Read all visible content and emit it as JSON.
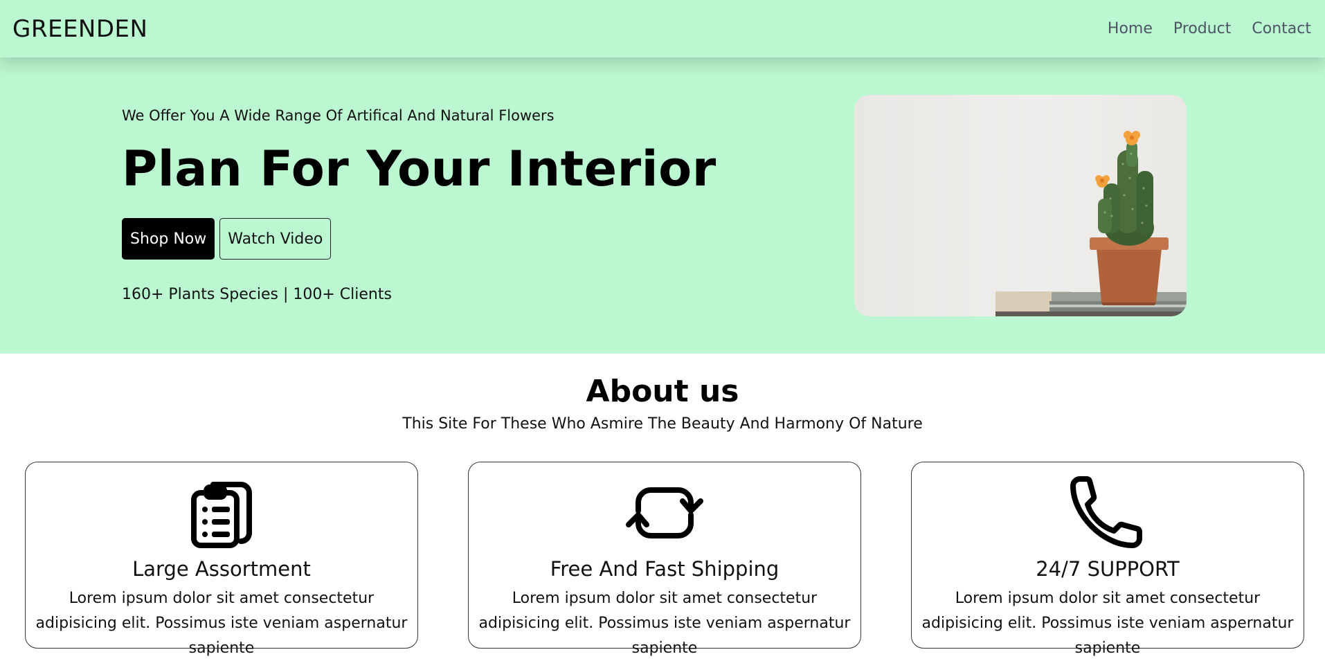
{
  "navbar": {
    "brand": "GREENDEN",
    "links": [
      "Home",
      "Product",
      "Contact"
    ]
  },
  "hero": {
    "tagline": "We Offer You A Wide Range Of Artifical And Natural Flowers",
    "title": "Plan For Your Interior",
    "shop_button": "Shop Now",
    "watch_button": "Watch Video",
    "stats": "160+ Plants Species | 100+ Clients",
    "image_icon": "cactus-in-pot-image"
  },
  "about": {
    "title": "About us",
    "subtitle": "This Site For These Who Asmire The Beauty And Harmony Of Nature",
    "cards": [
      {
        "icon": "clipboard-list-icon",
        "title": "Large Assortment",
        "text": "Lorem ipsum dolor sit amet consectetur adipisicing elit. Possimus iste veniam aspernatur sapiente"
      },
      {
        "icon": "refresh-icon",
        "title": "Free And Fast Shipping",
        "text": "Lorem ipsum dolor sit amet consectetur adipisicing elit. Possimus iste veniam aspernatur sapiente"
      },
      {
        "icon": "phone-icon",
        "title": "24/7 SUPPORT",
        "text": "Lorem ipsum dolor sit amet consectetur adipisicing elit. Possimus iste veniam aspernatur sapiente"
      }
    ]
  },
  "colors": {
    "hero_bg": "#bbf7d0",
    "nav_link": "#4b5563",
    "primary_button": "#000000"
  }
}
